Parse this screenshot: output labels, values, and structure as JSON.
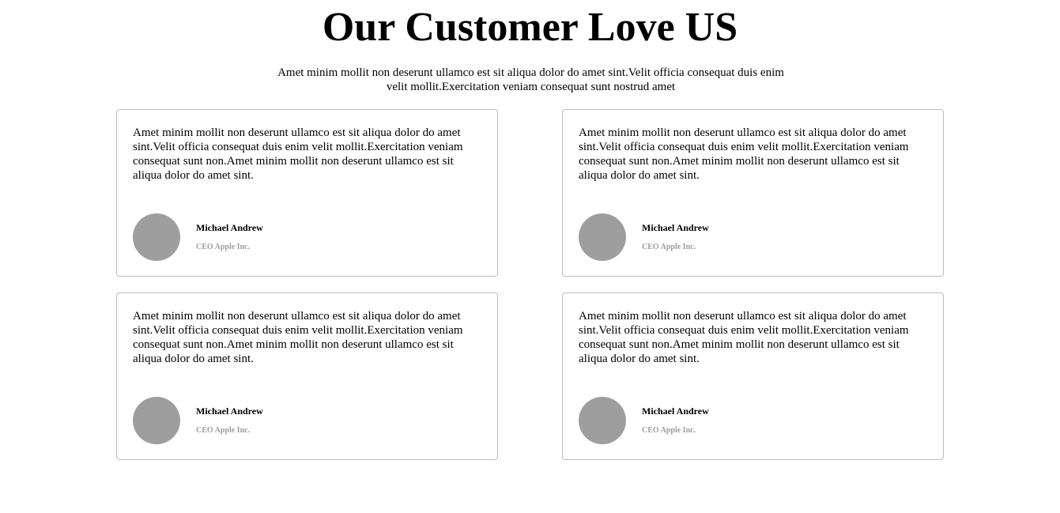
{
  "header": {
    "title": "Our Customer Love US",
    "subtitle": "Amet minim mollit non deserunt ullamco est sit aliqua dolor do amet sint.Velit officia consequat duis enim velit mollit.Exercitation veniam consequat sunt nostrud amet"
  },
  "testimonials": [
    {
      "quote": "Amet minim mollit non deserunt ullamco est sit aliqua dolor do amet sint.Velit officia consequat duis enim velit mollit.Exercitation veniam consequat sunt non.Amet minim mollit non deserunt ullamco est sit aliqua dolor do amet sint.",
      "name": "Michael Andrew",
      "role": "CEO Apple Inc."
    },
    {
      "quote": "Amet minim mollit non deserunt ullamco est sit aliqua dolor do amet sint.Velit officia consequat duis enim velit mollit.Exercitation veniam consequat sunt non.Amet minim mollit non deserunt ullamco est sit aliqua dolor do amet sint.",
      "name": "Michael Andrew",
      "role": "CEO Apple Inc."
    },
    {
      "quote": "Amet minim mollit non deserunt ullamco est sit aliqua dolor do amet sint.Velit officia consequat duis enim velit mollit.Exercitation veniam consequat sunt non.Amet minim mollit non deserunt ullamco est sit aliqua dolor do amet sint.",
      "name": "Michael Andrew",
      "role": "CEO Apple Inc."
    },
    {
      "quote": "Amet minim mollit non deserunt ullamco est sit aliqua dolor do amet sint.Velit officia consequat duis enim velit mollit.Exercitation veniam consequat sunt non.Amet minim mollit non deserunt ullamco est sit aliqua dolor do amet sint.",
      "name": "Michael Andrew",
      "role": "CEO Apple Inc."
    }
  ],
  "colors": {
    "avatar": "#9e9e9e",
    "card_border": "#bdbdbd",
    "role_text": "#9e9e9e"
  }
}
